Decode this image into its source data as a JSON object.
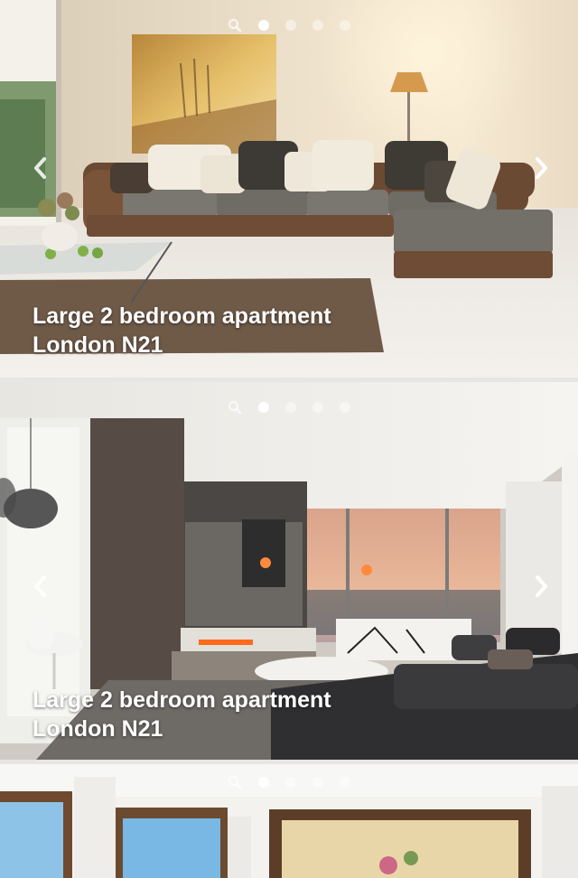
{
  "listings": [
    {
      "title_line1": "Large 2 bedroom apartment",
      "title_line2": "London N21",
      "active_slide": 1,
      "slide_count": 4
    },
    {
      "title_line1": "Large 2 bedroom apartment",
      "title_line2": "London N21",
      "active_slide": 1,
      "slide_count": 4
    },
    {
      "title_line1": "",
      "title_line2": "",
      "active_slide": 1,
      "slide_count": 4
    }
  ],
  "icons": {
    "pager_search": "search-icon",
    "prev": "chevron-left-icon",
    "next": "chevron-right-icon"
  },
  "colors": {
    "pager_active": "#ffffff",
    "pager_inactive": "rgba(255,255,255,0.45)",
    "caption_text": "#ffffff"
  }
}
